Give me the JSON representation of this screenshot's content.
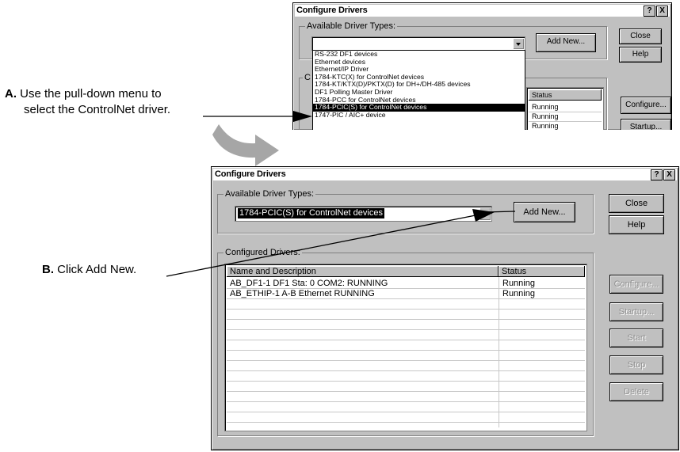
{
  "annotations": {
    "a_letter": "A.",
    "a_line1": "Use the pull-down menu to",
    "a_line2": "select the ControlNet driver.",
    "b_letter": "B.",
    "b_text": "Click Add New."
  },
  "top_window": {
    "title": "Configure Drivers",
    "help_glyph": "?",
    "close_glyph": "X",
    "available_label": "Available Driver Types:",
    "add_new": "Add New...",
    "close_btn": "Close",
    "help_btn": "Help",
    "configure_btn": "Configure...",
    "startup_btn": "Startup...",
    "configured_letter": "C",
    "status_header": "Status",
    "status_rows": [
      "Running",
      "Running",
      "Running"
    ],
    "dropdown_items": [
      "RS-232 DF1 devices",
      "Ethernet devices",
      "Ethernet/IP Driver",
      "1784-KTC(X) for ControlNet devices",
      "1784-KT/KTX(D)/PKTX(D) for DH+/DH-485 devices",
      "DF1 Polling Master Driver",
      "1784-PCC for ControlNet devices",
      "1784-PCIC(S) for ControlNet devices",
      "1747-PIC / AIC+ device"
    ],
    "selected_index": 7
  },
  "main_window": {
    "title": "Configure Drivers",
    "help_glyph": "?",
    "close_glyph": "X",
    "available_label": "Available Driver Types:",
    "selected_driver": "1784-PCIC(S) for ControlNet devices",
    "add_new": "Add New...",
    "close_btn": "Close",
    "help_btn": "Help",
    "configured_label": "Configured Drivers:",
    "col_name": "Name and Description",
    "col_status": "Status",
    "rows": [
      {
        "name": "AB_DF1-1  DF1 Sta: 0 COM2: RUNNING",
        "status": "Running"
      },
      {
        "name": "AB_ETHIP-1  A-B Ethernet  RUNNING",
        "status": "Running"
      }
    ],
    "configure_btn": "Configure...",
    "startup_btn": "Startup...",
    "start_btn": "Start",
    "stop_btn": "Stop",
    "delete_btn": "Delete"
  }
}
